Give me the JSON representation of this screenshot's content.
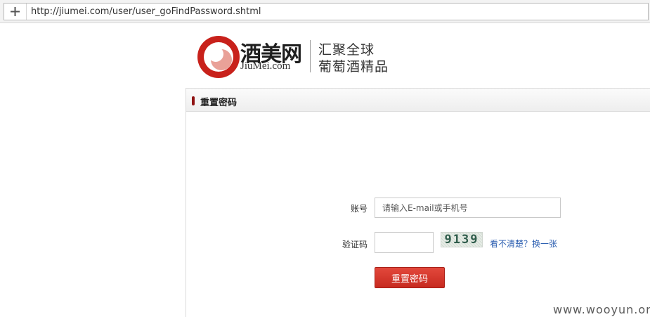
{
  "browser": {
    "url": "http://jiumei.com/user/user_goFindPassword.shtml"
  },
  "logo": {
    "name_cn": "酒美网",
    "name_en": "JiuMei.com",
    "slogan_line1": "汇聚全球",
    "slogan_line2": "葡萄酒精品",
    "brand_color": "#c8211b"
  },
  "panel": {
    "title": "重置密码",
    "marker_color": "#8f1212"
  },
  "form": {
    "account_label": "账号",
    "account_placeholder": "请输入E-mail或手机号",
    "captcha_label": "验证码",
    "captcha_value": "",
    "captcha_code": "9139",
    "captcha_refresh": "看不清楚？换一张",
    "submit_label": "重置密码"
  },
  "watermark": "www.wooyun.org"
}
